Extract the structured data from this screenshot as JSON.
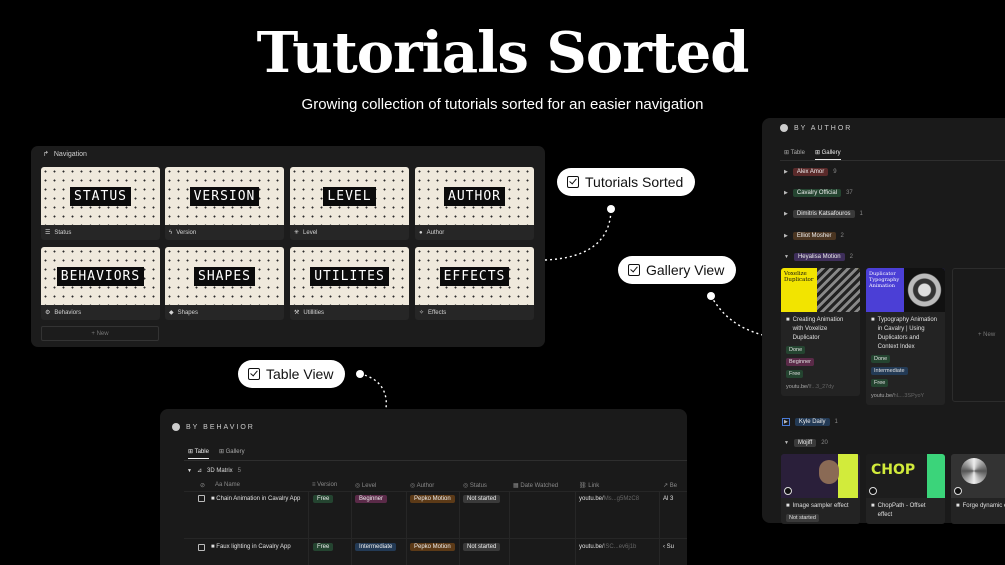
{
  "hero": {
    "title": "Tutorials Sorted",
    "subtitle": "Growing collection of tutorials sorted for an easier navigation"
  },
  "navigation": {
    "header": "Navigation",
    "new_label": "+ New",
    "cards": [
      {
        "art": "STATUS",
        "label": "Status",
        "icon": "list-icon"
      },
      {
        "art": "VERSION",
        "label": "Version",
        "icon": "bolt-icon"
      },
      {
        "art": "LEVEL",
        "label": "Level",
        "icon": "asterisk-icon"
      },
      {
        "art": "AUTHOR",
        "label": "Author",
        "icon": "person-icon"
      },
      {
        "art": "BEHAVIORS",
        "label": "Behaviors",
        "icon": "gear-icon"
      },
      {
        "art": "SHAPES",
        "label": "Shapes",
        "icon": "shapes-icon"
      },
      {
        "art": "UTILITES",
        "label": "Utillities",
        "icon": "hammer-icon"
      },
      {
        "art": "EFFECTS",
        "label": "Effects",
        "icon": "sparkle-icon"
      }
    ]
  },
  "pills": {
    "tutorials_sorted": "Tutorials Sorted",
    "gallery_view": "Gallery View",
    "table_view": "Table View"
  },
  "by_author": {
    "title": "BY AUTHOR",
    "tabs": [
      "Table",
      "Gallery"
    ],
    "groups": [
      {
        "name": "Alex Amor",
        "count": "9"
      },
      {
        "name": "Cavalry Official",
        "count": "37"
      },
      {
        "name": "Dimitris Katsafouros",
        "count": "1"
      },
      {
        "name": "Elliot Mosher",
        "count": "2"
      },
      {
        "name": "Heyalisa Motion",
        "count": "2"
      },
      {
        "name": "Kyle Daily",
        "count": "1"
      },
      {
        "name": "Mojiff",
        "count": "20"
      }
    ],
    "gallery_cards": [
      {
        "thumb_text": "Voxelize Duplicator",
        "title": "Creating Animation with Voxelize Duplicator",
        "badges": [
          "Done",
          "Beginner",
          "Free"
        ],
        "link_a": "youtu.be/",
        "link_b": "lf...3_27dy"
      },
      {
        "thumb_text": "Duplicator Typography Animation",
        "title": "Typography Animation in Cavalry | Using Duplicators and Context Index",
        "badges": [
          "Done",
          "Intermediate",
          "Free"
        ],
        "link_a": "youtu.be/",
        "link_b": "hL...3SPyoY"
      }
    ],
    "new_label": "+ New",
    "mojiff_cards": [
      {
        "thumb_text": "",
        "title": "Image sampler effect",
        "badge": "Not started"
      },
      {
        "thumb_text": "CHOP",
        "title": "ChopPath - Offset effect",
        "badge": ""
      },
      {
        "thumb_text": "",
        "title": "Forge dynamic effect",
        "badge": ""
      }
    ]
  },
  "by_behavior": {
    "title": "BY BEHAVIOR",
    "tabs": [
      "Table",
      "Gallery"
    ],
    "group": {
      "name": "3D Matrix",
      "count": "5"
    },
    "columns": [
      "Aa Name",
      "Version",
      "Level",
      "Author",
      "Status",
      "Date Watched",
      "Link",
      "Be"
    ],
    "rows": [
      {
        "name": "Chain Animation in Cavalry App",
        "version": "Free",
        "level": "Beginner",
        "author": "Pepko Motion",
        "status": "Not started",
        "link_a": "youtu.be/",
        "link_b": "Ms...g5MzC8",
        "be": "Al 3"
      },
      {
        "name": "Faux lighting in Cavalry App",
        "version": "Free",
        "level": "Intermediate",
        "author": "Pepko Motion",
        "status": "Not started",
        "link_a": "youtu.be/",
        "link_b": "ISC...ev6j1b",
        "be": "Su"
      }
    ]
  }
}
